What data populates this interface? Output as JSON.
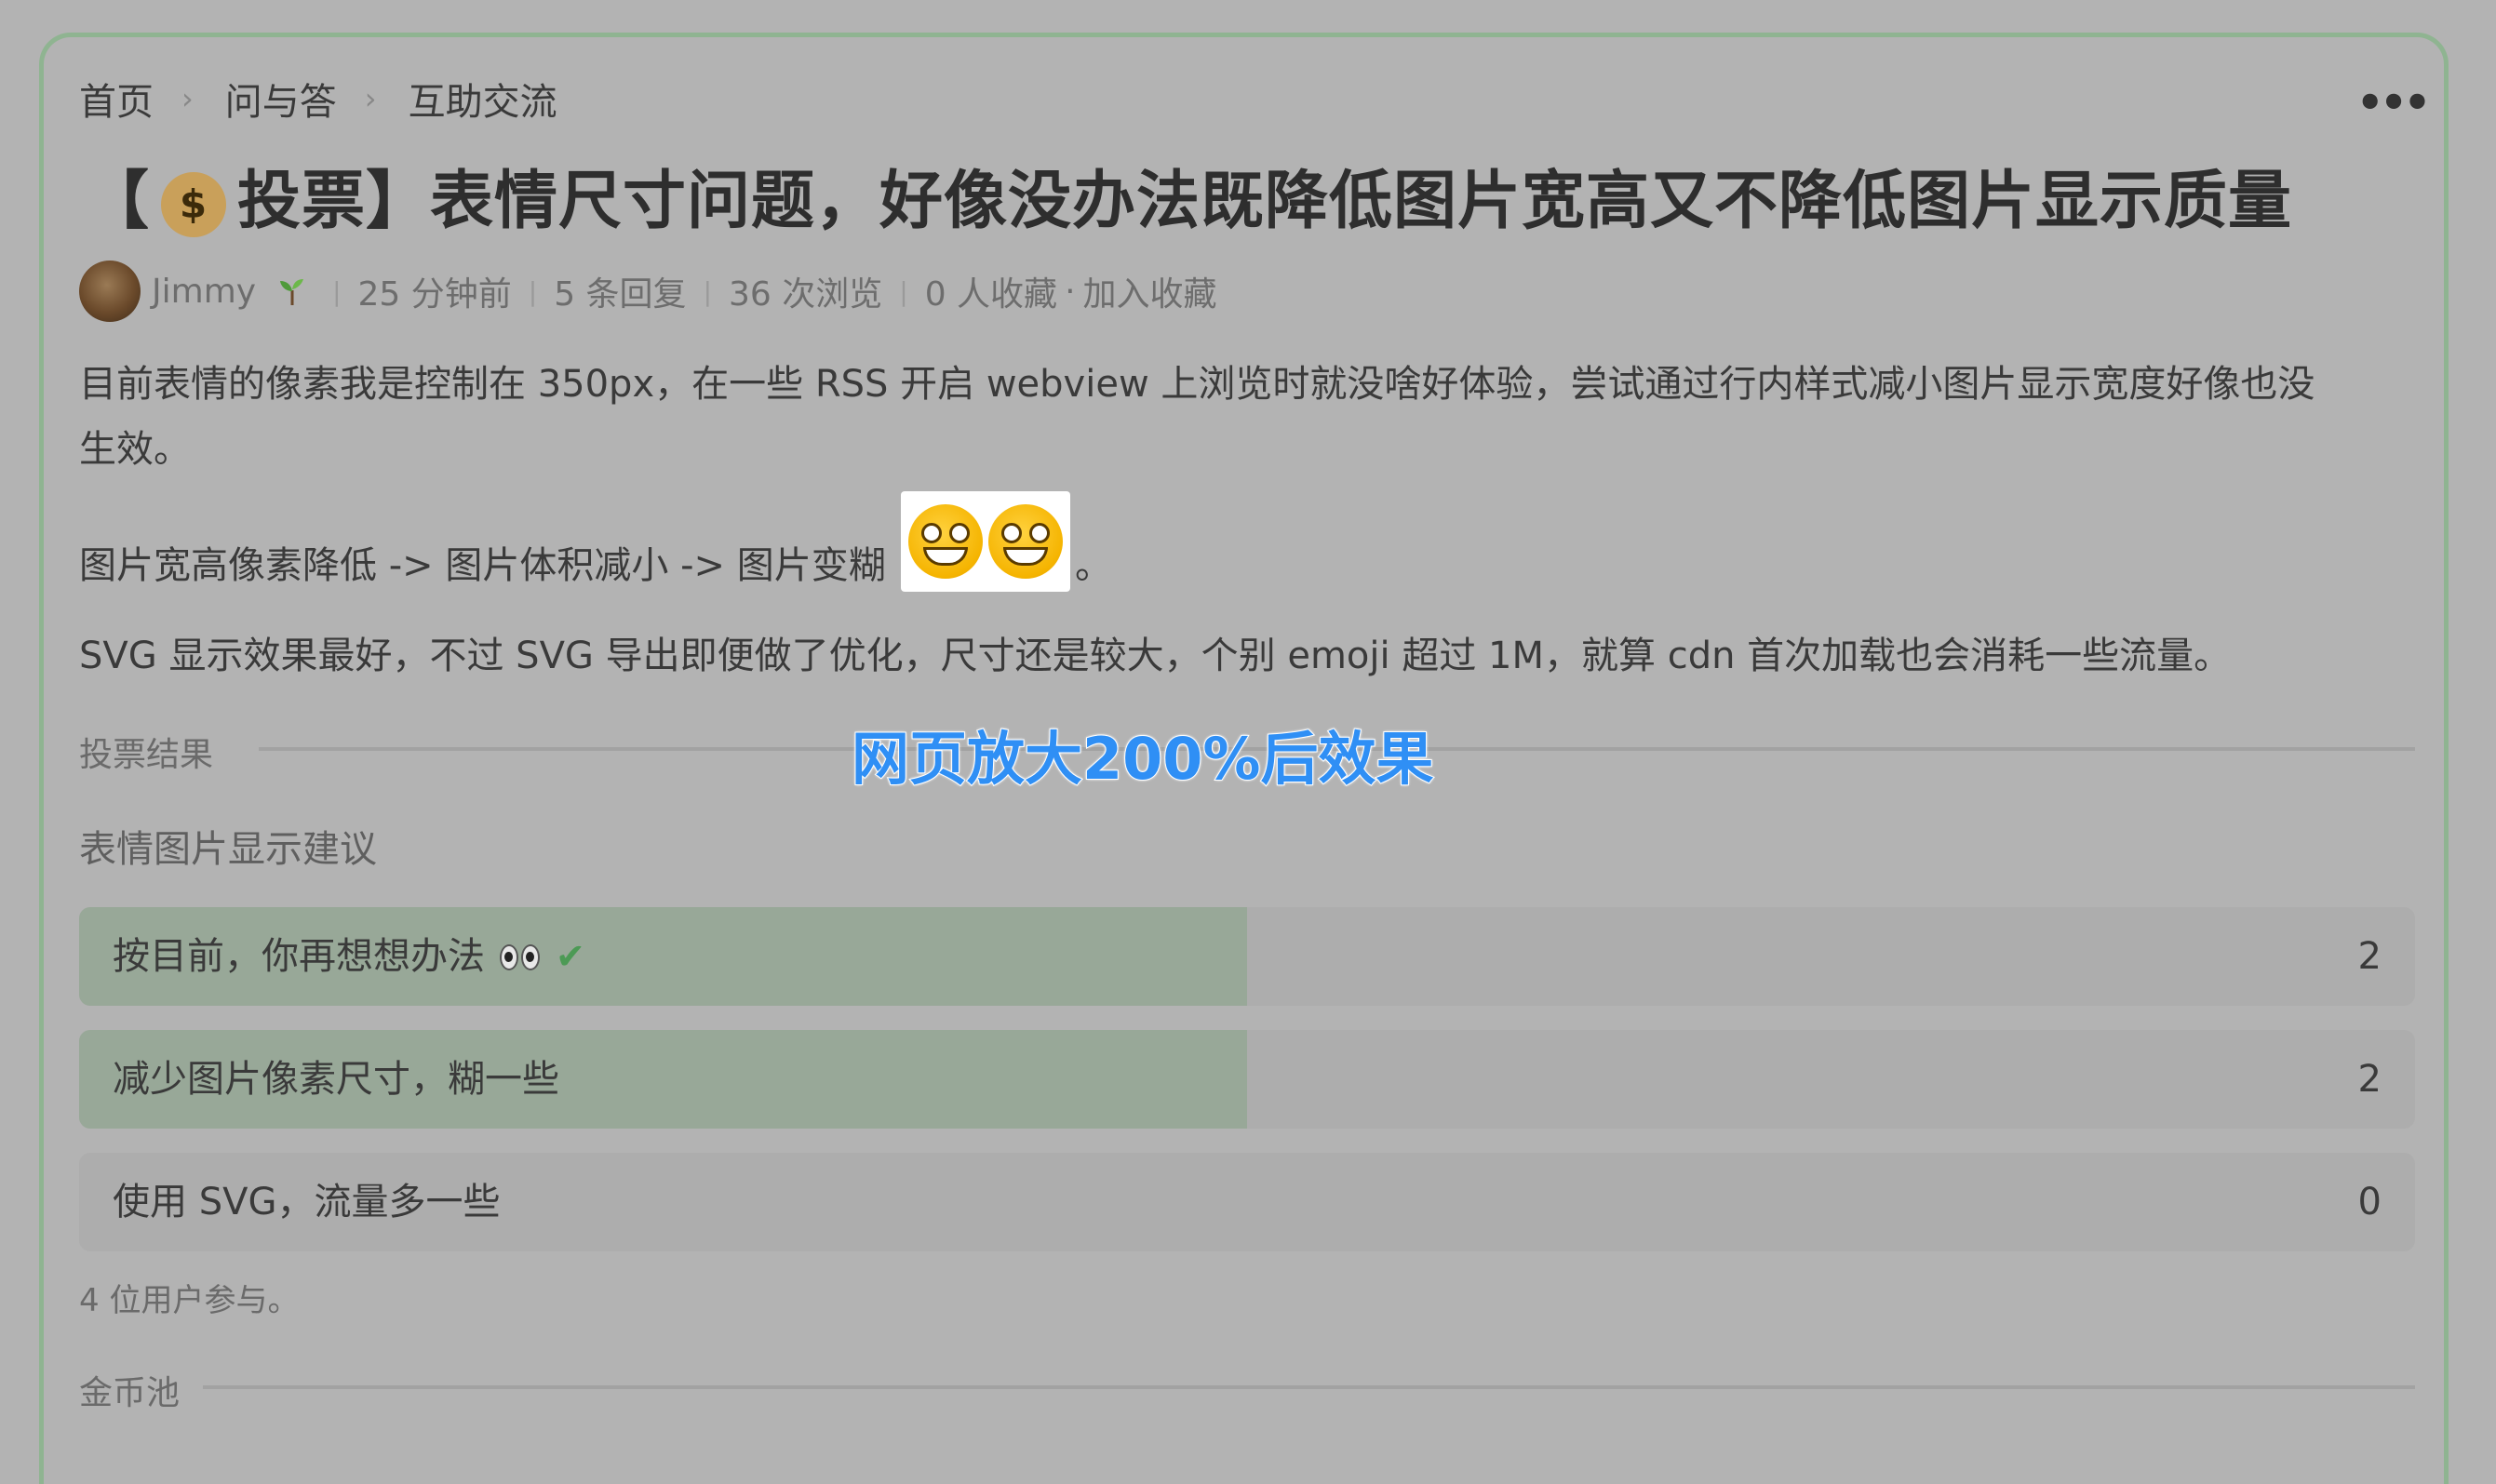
{
  "breadcrumb": {
    "items": [
      "首页",
      "问与答",
      "互助交流"
    ],
    "separator": "›"
  },
  "more_menu": {
    "glyph": "•••"
  },
  "title": {
    "prefix": "【",
    "icon": "money-bag-icon",
    "icon_glyph": "$",
    "text": "投票】表情尺寸问题，好像没办法既降低图片宽高又不降低图片显示质量"
  },
  "meta": {
    "author": "Jimmy",
    "author_badge_icon": "sprout-icon",
    "time": "25 分钟前",
    "replies": "5 条回复",
    "views": "36 次浏览",
    "bookmarks": "0 人收藏",
    "dot": "·",
    "add_bookmark": "加入收藏",
    "sep": "|"
  },
  "body": {
    "p1_line1": "目前表情的像素我是控制在 350px，在一些 RSS 开启 webview 上浏览时就没啥好体验，尝试通过行内样式减小图片显示宽度好像也没",
    "p1_line2": "生效。",
    "p2_text": "图片宽高像素降低 -> 图片体积减小 -> 图片变糊",
    "p2_suffix": "。",
    "p2_emojis": [
      "grinning-face-icon",
      "grinning-face-icon"
    ],
    "p3": "SVG 显示效果最好，不过 SVG 导出即便做了优化，尺寸还是较大，个别 emoji 超过 1M，就算 cdn 首次加载也会消耗一些流量。"
  },
  "overlay_text": "网页放大200%后效果",
  "poll": {
    "section_label": "投票结果",
    "question": "表情图片显示建议",
    "options": [
      {
        "label": "按目前，你再想想办法",
        "count": "2",
        "fraction": 0.5,
        "eyes_icon": "eyes-icon",
        "voted": true,
        "check_glyph": "✔"
      },
      {
        "label": "减少图片像素尺寸，糊一些",
        "count": "2",
        "fraction": 0.5,
        "voted": false
      },
      {
        "label": "使用 SVG，流量多一些",
        "count": "0",
        "fraction": 0,
        "voted": false
      }
    ],
    "participants": "4 位用户参与。"
  },
  "coin_pool": {
    "section_label": "金币池"
  },
  "colors": {
    "card_border": "#8fb491",
    "vote_fill": "#98a898",
    "check": "#4c9a55",
    "overlay": "#2f8ff5"
  }
}
